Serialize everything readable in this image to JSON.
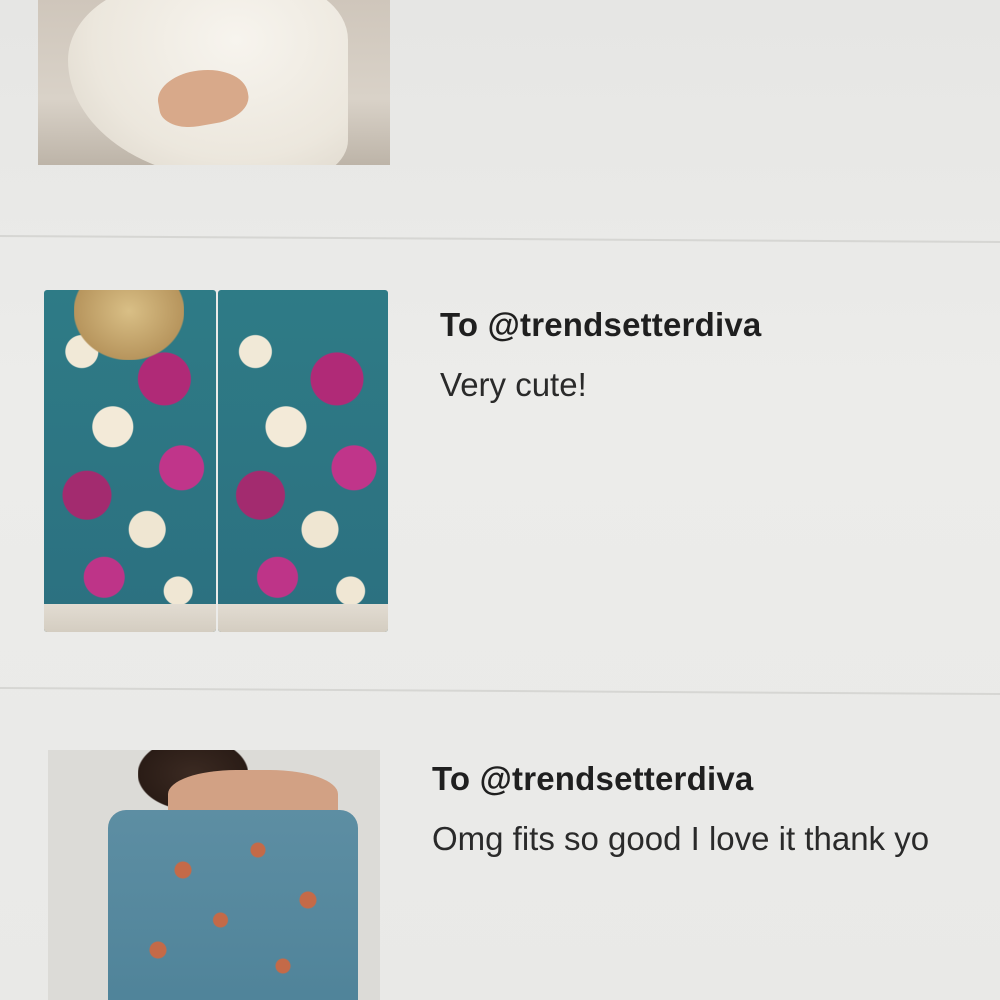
{
  "conversation": {
    "messages": [
      {
        "recipient": "To @trendsetterdiva",
        "text": "Very cute!",
        "image": "floral-dress-photo"
      },
      {
        "recipient": "To @trendsetterdiva",
        "text": "Omg fits so good I love it thank yo",
        "image": "off-shoulder-dress-photo"
      }
    ],
    "top_partial_item": {
      "image": "white-dress-photo"
    }
  }
}
